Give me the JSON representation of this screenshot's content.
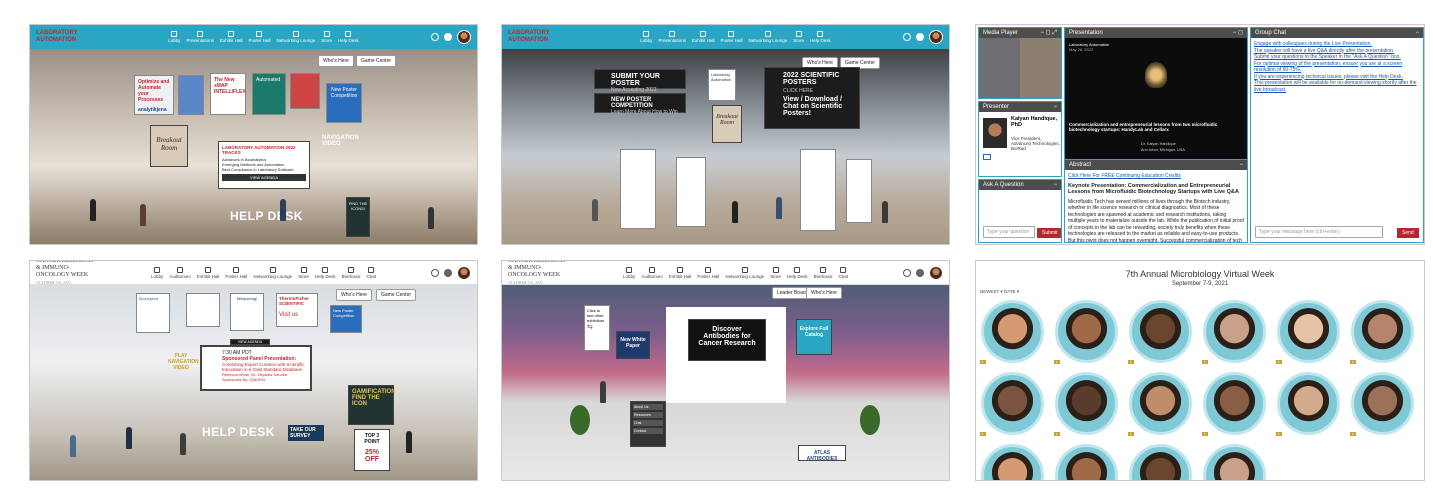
{
  "panel1": {
    "brand": "LABORATORY AUTOMATION",
    "nav": [
      "Lobby",
      "Presentations",
      "Exhibit Hall",
      "Poster Hall",
      "Networking Lounge",
      "Store",
      "Help Desk"
    ],
    "whos_here": "Who's Here",
    "game_center": "Game Center",
    "banners": [
      "Optimize and Automate your Processes",
      "The New sMAP INTELLIFLEX",
      "Automated",
      "New Poster Competition"
    ],
    "analytik": "analytikjena",
    "breakout": "Breakout Room",
    "screen_title": "LABORATORY AUTOMATION 2022 TRACKS",
    "screen_view": "VIEW AGENDA",
    "tracks": [
      "Advances in Bioanalytics",
      "Emerging Methods and Automation",
      "Best Compliance in Laboratory Software"
    ],
    "navigation": "NAVIGATION VIDEO",
    "help_desk": "HELP DESK",
    "side_sign": "FIND THE ICONS!"
  },
  "panel2": {
    "nav": [
      "Lobby",
      "Presentations",
      "Exhibit Hall",
      "Poster Hall",
      "Networking Lounge",
      "Store",
      "Help Desk"
    ],
    "whos_here": "Who's Here",
    "game_center": "Game Center",
    "submit_title": "SUBMIT YOUR POSTER",
    "submit_sub": "Now Accepting 2022 Submissions",
    "comp_title": "NEW POSTER COMPETITION",
    "comp_sub": "Learn More About How to Win",
    "posters_title": "2022 SCIENTIFIC POSTERS",
    "posters_click": "CLICK HERE",
    "posters_cta": "View / Download / Chat on Scientific Posters!",
    "lab_auto": "Laboratory Automation",
    "breakout": "Breakout Room"
  },
  "panel3": {
    "media_player": "Media Player",
    "presentation": "Presentation",
    "group_chat": "Group Chat",
    "slide_org": "Laboratory Automation",
    "slide_date": "May 26, 2022",
    "slide_title": "Commercialization and entrepreneurial lessons from two microfluidic biotechnology startups: HandyLab and Cellarx",
    "slide_author": "Dr. Kalyan Handique",
    "slide_place": "Ann Arbor, Michigan, USA",
    "presenter_label": "Presenter",
    "presenter_name": "Kalyan Handique, PhD",
    "presenter_title": "Vice President, Advanced Technologies, BioRad",
    "abstract_label": "Abstract",
    "ce_link": "Click Here For FREE Continuing Education Credits",
    "keynote": "Keynote Presentation: Commercialization and Entrepreneurial Lessons from Microfluidic Biotechnology Startups with Live Q&A",
    "abstract_text": "Microfluidic Tech has served millions of lives through the Biotech industry, whether in life science research or clinical diagnostics. Most of these technologies are spawned at academic and research institutions, taking multiple years to materialize outside the lab. While the publication of initial proof of concepts in the lab can be rewarding, society truly benefits when these technologies are released to the market as reliable and easy-to-use products. But this pivot does not happen overnight. Successful commercialization of tech requires the tremendous efforts of",
    "ask_label": "Ask A Question",
    "ask_placeholder": "Type your question",
    "submit": "Submit",
    "chat_lines": [
      "Engage with colleagues during the Live Presentation.",
      "The speaker will have a live Q&A directly after the presentation.",
      "Submit your questions to the Speaker in the \"Ask A Question\" box.",
      "For optimal viewing of the presentation, ensure you are at a screen resolution of 90-75%.",
      "If you are experiencing technical issues, please visit the Help Desk.",
      "This presentation will be available for on-demand viewing shortly after the live broadcast."
    ],
    "chat_placeholder": "Type your message here (ctrl+enter)",
    "send": "Send"
  },
  "panel4": {
    "brand": "CANCER RESEARCH & IMMUNO-ONCOLOGY WEEK",
    "brand_date": "OCTOBER 3-6, 2022",
    "nav": [
      "Lobby",
      "Auditorium",
      "Exhibit Hall",
      "Poster Hall",
      "Networking Lounge",
      "Store",
      "Help Desk",
      "Briefcase",
      "Chat"
    ],
    "whos_here": "Who's Here",
    "game_center": "Game Center",
    "sponsor_logos": [
      "BioLegend",
      "Milliporeagl"
    ],
    "thermo": "ThermoFisher SCIENTIFIC",
    "visit_us": "Visit us",
    "new_poster": "New Poster Competition",
    "time": "7:30 AM PDT",
    "sponsored": "Sponsored Panel Presentation:",
    "session": "Combining Expert Curation with Scientific Innovation in a Gold Standard Database",
    "speakers": "Rebecca White, Dr. Zbyslaw Sondka",
    "sponsor": "Sponsored By: QIAGEN",
    "view_agenda": "VIEW AGENDA",
    "navigation": "PLAY NAVIGATION VIDEO",
    "help_desk": "HELP DESK",
    "survey": "TAKE OUR SURVEY",
    "game_title": "GAMIFICATION FIND THE ICON",
    "top3": "TOP 3 POINT",
    "discount": "25% OFF"
  },
  "panel5": {
    "brand": "CANCER RESEARCH & IMMUNO-ONCOLOGY WEEK",
    "brand_date": "OCTOBER 3-6, 2022",
    "nav": [
      "Lobby",
      "Auditorium",
      "Exhibit Hall",
      "Poster Hall",
      "Networking Lounge",
      "Store",
      "Help Desk",
      "Briefcase",
      "Chat"
    ],
    "leader_board": "Leader Board",
    "whos_here": "Who's Here",
    "click_exhibitors": "Click to see other exhibitors",
    "white_paper": "New White Paper",
    "headline": "Discover Antibodies for Cancer Research",
    "explore": "Explore Full Catalog",
    "company": "ATLAS ANTIBODIES",
    "menu_items": [
      "About Us",
      "Resources",
      "Chat",
      "Contact"
    ]
  },
  "panel6": {
    "title": "7th Annual Microbiology Virtual Week",
    "dates": "September 7-9, 2021",
    "filters": "NEWEST ▾   DATE ▾",
    "tile_colors": [
      "#d59a74",
      "#a06a48",
      "#6b4530",
      "#c9a089",
      "#e6c3a6",
      "#b4856a",
      "#7a5440",
      "#5a3b2c",
      "#c08d6b",
      "#8a5e44",
      "#d1ab8c",
      "#9b7259"
    ],
    "badge": "L"
  }
}
